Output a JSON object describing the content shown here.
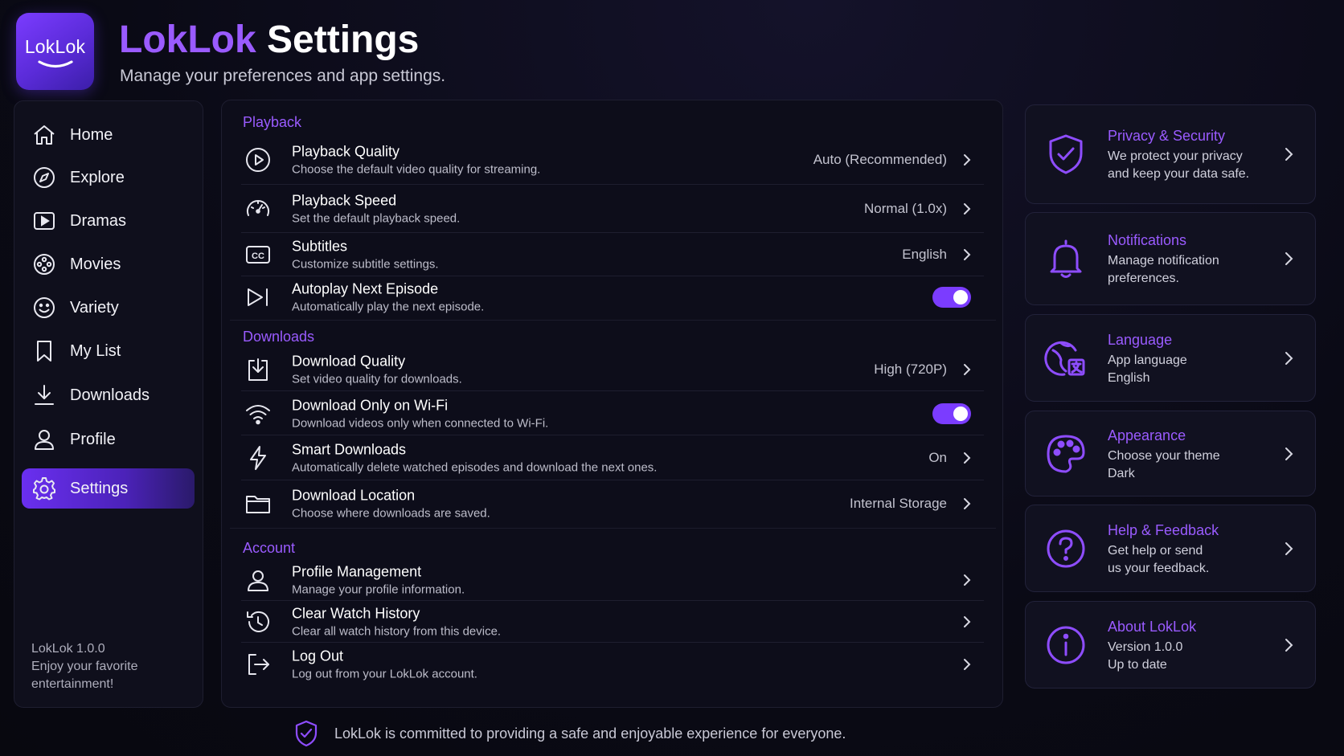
{
  "app": {
    "logo_text": "LokLok",
    "title_brand": "LokLok",
    "title_rest": "Settings",
    "subtitle": "Manage your preferences and app settings."
  },
  "colors": {
    "accent": "#9a5bff",
    "toggle_on": "#7b3cff",
    "background": "#0a0a15"
  },
  "sidebar": {
    "items": [
      {
        "label": "Home",
        "icon": "home-icon"
      },
      {
        "label": "Explore",
        "icon": "compass-icon"
      },
      {
        "label": "Dramas",
        "icon": "play-square-icon"
      },
      {
        "label": "Movies",
        "icon": "film-reel-icon"
      },
      {
        "label": "Variety",
        "icon": "smiley-icon"
      },
      {
        "label": "My List",
        "icon": "bookmark-icon"
      },
      {
        "label": "Downloads",
        "icon": "download-icon"
      },
      {
        "label": "Profile",
        "icon": "user-icon"
      },
      {
        "label": "Settings",
        "icon": "gear-icon",
        "active": true
      }
    ],
    "footer": {
      "version": "LokLok 1.0.0",
      "tagline_1": "Enjoy your favorite",
      "tagline_2": "entertainment!"
    }
  },
  "playback": {
    "heading": "Playback",
    "quality": {
      "title": "Playback Quality",
      "desc": "Choose the default video quality for streaming.",
      "value": "Auto (Recommended)"
    },
    "speed": {
      "title": "Playback Speed",
      "desc": "Set the default playback speed.",
      "value": "Normal (1.0x)"
    },
    "subtitles": {
      "title": "Subtitles",
      "desc": "Customize subtitle settings.",
      "value": "English"
    },
    "autoplay": {
      "title": "Autoplay Next Episode",
      "desc": "Automatically play the next episode.",
      "enabled": true
    }
  },
  "downloads": {
    "heading": "Downloads",
    "quality": {
      "title": "Download Quality",
      "desc": "Set video quality for downloads.",
      "value": "High (720P)"
    },
    "wifi_only": {
      "title": "Download Only on Wi-Fi",
      "desc": "Download videos only when connected to Wi-Fi.",
      "enabled": true
    },
    "smart": {
      "title": "Smart Downloads",
      "desc": "Automatically delete watched episodes and download the next ones.",
      "value": "On"
    },
    "location": {
      "title": "Download Location",
      "desc": "Choose where downloads are saved.",
      "value": "Internal Storage"
    }
  },
  "account": {
    "heading": "Account",
    "profile": {
      "title": "Profile Management",
      "desc": "Manage your profile information."
    },
    "clear_history": {
      "title": "Clear Watch History",
      "desc": "Clear all watch history from this device."
    },
    "logout": {
      "title": "Log Out",
      "desc": "Log out from your LokLok account."
    }
  },
  "cards": {
    "privacy": {
      "title": "Privacy & Security",
      "line1": "We protect your privacy",
      "line2": "and keep your data safe.",
      "icon": "shield-check-icon"
    },
    "notifications": {
      "title": "Notifications",
      "line1": "Manage notification",
      "line2": "preferences.",
      "icon": "bell-icon"
    },
    "language": {
      "title": "Language",
      "line1": "App language",
      "line2": "English",
      "icon": "globe-translate-icon"
    },
    "appearance": {
      "title": "Appearance",
      "line1": "Choose your theme",
      "line2": "Dark",
      "icon": "palette-icon"
    },
    "help": {
      "title": "Help & Feedback",
      "line1": "Get help or send",
      "line2": "us your feedback.",
      "icon": "question-circle-icon"
    },
    "about": {
      "title": "About LokLok",
      "line1": "Version 1.0.0",
      "line2": "Up to date",
      "icon": "info-circle-icon"
    }
  },
  "footer_note": "LokLok is committed to providing a safe and enjoyable experience for everyone."
}
